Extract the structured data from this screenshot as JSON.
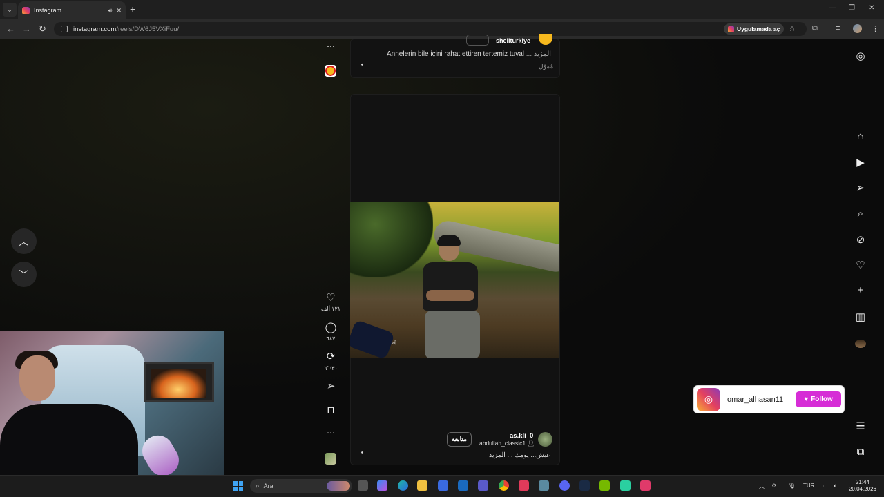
{
  "browser": {
    "tab_title": "Instagram",
    "url_host": "instagram.com",
    "url_path": "/reels/DW6J5VXiFuu/",
    "open_in_app_label": "Uygulamada aç"
  },
  "reel_top": {
    "username": "shellturkiye",
    "caption": "Annelerin bile içini rahat ettiren tertemiz tuval",
    "more_label": "... المزيد",
    "audio_label": "مُموَّل"
  },
  "reel_main": {
    "username": "as.kli_0",
    "collaborator": "abdullah_classic1",
    "follow_label": "متابعة",
    "caption": "عيش... يومك ... المزيد"
  },
  "actions": {
    "likes": "١٢١ ألف",
    "comments": "٦٨٧",
    "reposts": "٦٬٦٣٠"
  },
  "follow_card": {
    "username": "omar_alhasan11",
    "button_label": "Follow"
  },
  "taskbar": {
    "search_placeholder": "Ara",
    "language": "TUR",
    "time": "21:44",
    "date": "20.04.2026"
  },
  "icons": {
    "brand_gradient": [
      "#f9b233",
      "#e4405f",
      "#8a3ab9"
    ],
    "follow_button_color": "#d62dd6"
  }
}
